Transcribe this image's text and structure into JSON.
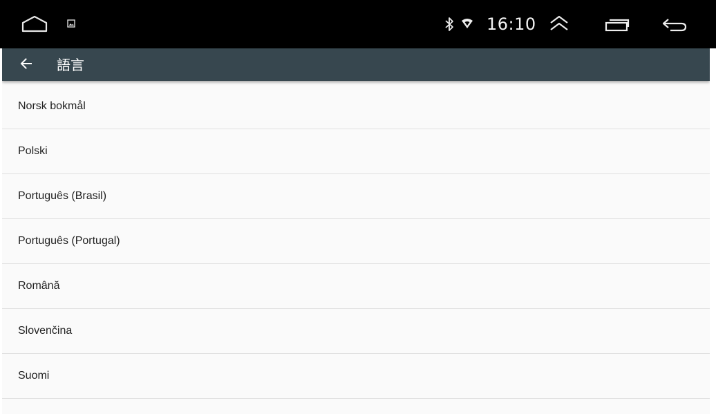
{
  "status_bar": {
    "time": "16:10",
    "icons": {
      "home": "home-icon",
      "notification": "image-notification-icon",
      "bluetooth": "bluetooth-icon",
      "wifi": "wifi-icon",
      "expand": "expand-up-icon",
      "recents": "recent-apps-icon",
      "back": "back-icon"
    }
  },
  "toolbar": {
    "title": "語言",
    "back_icon": "arrow-left-icon",
    "background_color": "#37474f"
  },
  "languages": [
    {
      "label": "Norsk bokmål"
    },
    {
      "label": "Polski"
    },
    {
      "label": "Português (Brasil)"
    },
    {
      "label": "Português (Portugal)"
    },
    {
      "label": "Română"
    },
    {
      "label": "Slovenčina"
    },
    {
      "label": "Suomi"
    }
  ]
}
